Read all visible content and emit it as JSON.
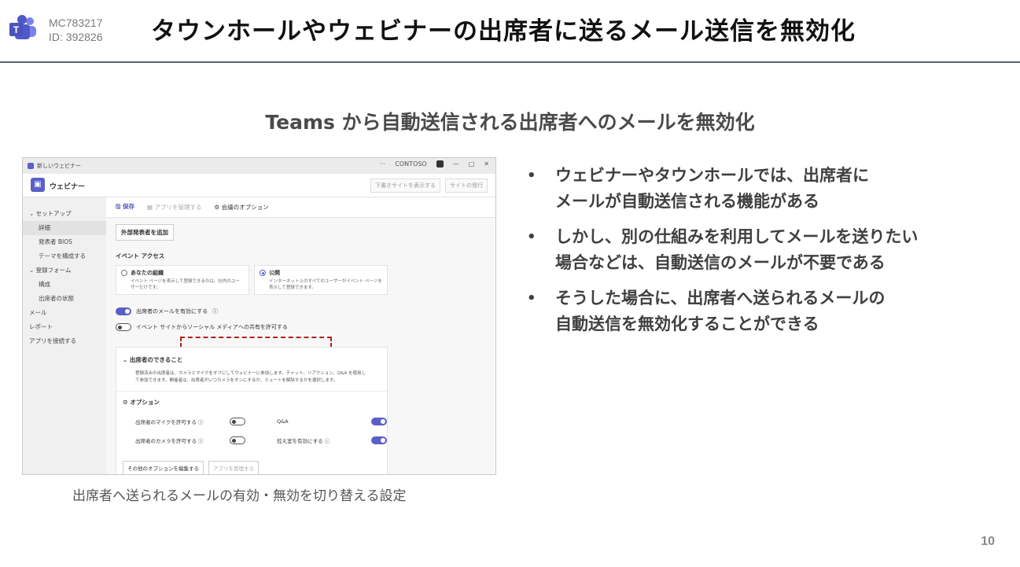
{
  "header": {
    "mc_id": "MC783217",
    "id_line": "ID: 392826",
    "title": "タウンホールやウェビナーの出席者に送るメール送信を無効化"
  },
  "subtitle": "Teams から自動送信される出席者へのメールを無効化",
  "bullets": [
    {
      "line1": "ウェビナーやタウンホールでは、出席者に",
      "line2": "メールが自動送信される機能がある"
    },
    {
      "line1": "しかし、別の仕組みを利用してメールを送りたい",
      "line2": "場合などは、自動送信のメールが不要である"
    },
    {
      "line1": "そうした場合に、出席者へ送られるメールの",
      "line2": "自動送信を無効化することができる"
    }
  ],
  "caption": "出席者へ送られるメールの有効・無効を切り替える設定",
  "page_number": "10",
  "screenshot": {
    "window_title": "新しいウェビナー",
    "org_name": "CONTOSO",
    "window_controls": [
      "···",
      "—",
      "□",
      "✕"
    ],
    "app_name": "ウェビナー",
    "app_buttons": [
      "下書きサイトを表示する",
      "サイトの発行"
    ],
    "sidebar": [
      {
        "label": "セットアップ",
        "type": "group"
      },
      {
        "label": "詳細",
        "type": "active"
      },
      {
        "label": "発表者 BIOS",
        "type": "sub"
      },
      {
        "label": "テーマを構成する",
        "type": "sub"
      },
      {
        "label": "登録フォーム",
        "type": "group"
      },
      {
        "label": "構成",
        "type": "sub"
      },
      {
        "label": "出席者の状態",
        "type": "sub"
      },
      {
        "label": "メール",
        "type": "item"
      },
      {
        "label": "レポート",
        "type": "item"
      },
      {
        "label": "アプリを接続する",
        "type": "item"
      }
    ],
    "toolbar": {
      "save": "保存",
      "manage_apps": "アプリを管理する",
      "meeting_options": "会議のオプション"
    },
    "add_presenter": "外部発表者を追加",
    "event_access_label": "イベント アクセス",
    "access_options": [
      {
        "title": "あなたの組織",
        "desc": "イベント ページを表示して登録できるのは、社内のユーザーだけです。"
      },
      {
        "title": "公開",
        "desc": "インターネット上のすべてのユーザーがイベント ページを表示して登録できます。"
      }
    ],
    "toggle_email": "出席者のメールを有効にする",
    "toggle_social": "イベント サイトからソーシャル メディアへの共有を許可する",
    "attendee_panel": {
      "header": "出席者のできること",
      "desc": "登録済みの出席者は、カメラとマイクをオフにしてウェビナーに参加します。チャット、リアクション、Q&A を使用して参加できます。開催者は、出席者がいつカメラをオンにするか、ミュートを解除するかを選択します。",
      "options_title": "オプション",
      "mic": "出席者のマイクを許可する",
      "qa": "Q&A",
      "camera": "出席者のカメラを許可する",
      "greenroom": "控え室を有効にする",
      "edit_more": "その他のオプションを編集する",
      "manage_apps": "アプリを管理する"
    }
  }
}
